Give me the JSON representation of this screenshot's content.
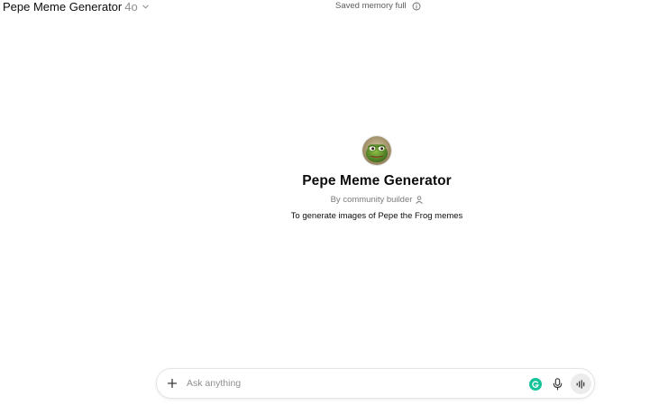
{
  "header": {
    "title": "Pepe Meme Generator",
    "model_version": "4o",
    "memory_status": "Saved memory full"
  },
  "intro": {
    "name": "Pepe Meme Generator",
    "byline": "By community builder",
    "description": "To generate images of Pepe the Frog memes"
  },
  "composer": {
    "placeholder": "Ask anything",
    "value": ""
  },
  "icons": {
    "chevron": "chevron-down-icon",
    "info": "info-icon",
    "person": "person-icon",
    "attach": "plus-icon",
    "grammarly": "grammarly-icon",
    "mic": "microphone-icon",
    "voice": "voice-mode-icon"
  },
  "colors": {
    "text": "#0d0d0d",
    "muted": "#8f8f8f",
    "grammarly": "#15c39a",
    "voice_button_bg": "#ececec"
  }
}
